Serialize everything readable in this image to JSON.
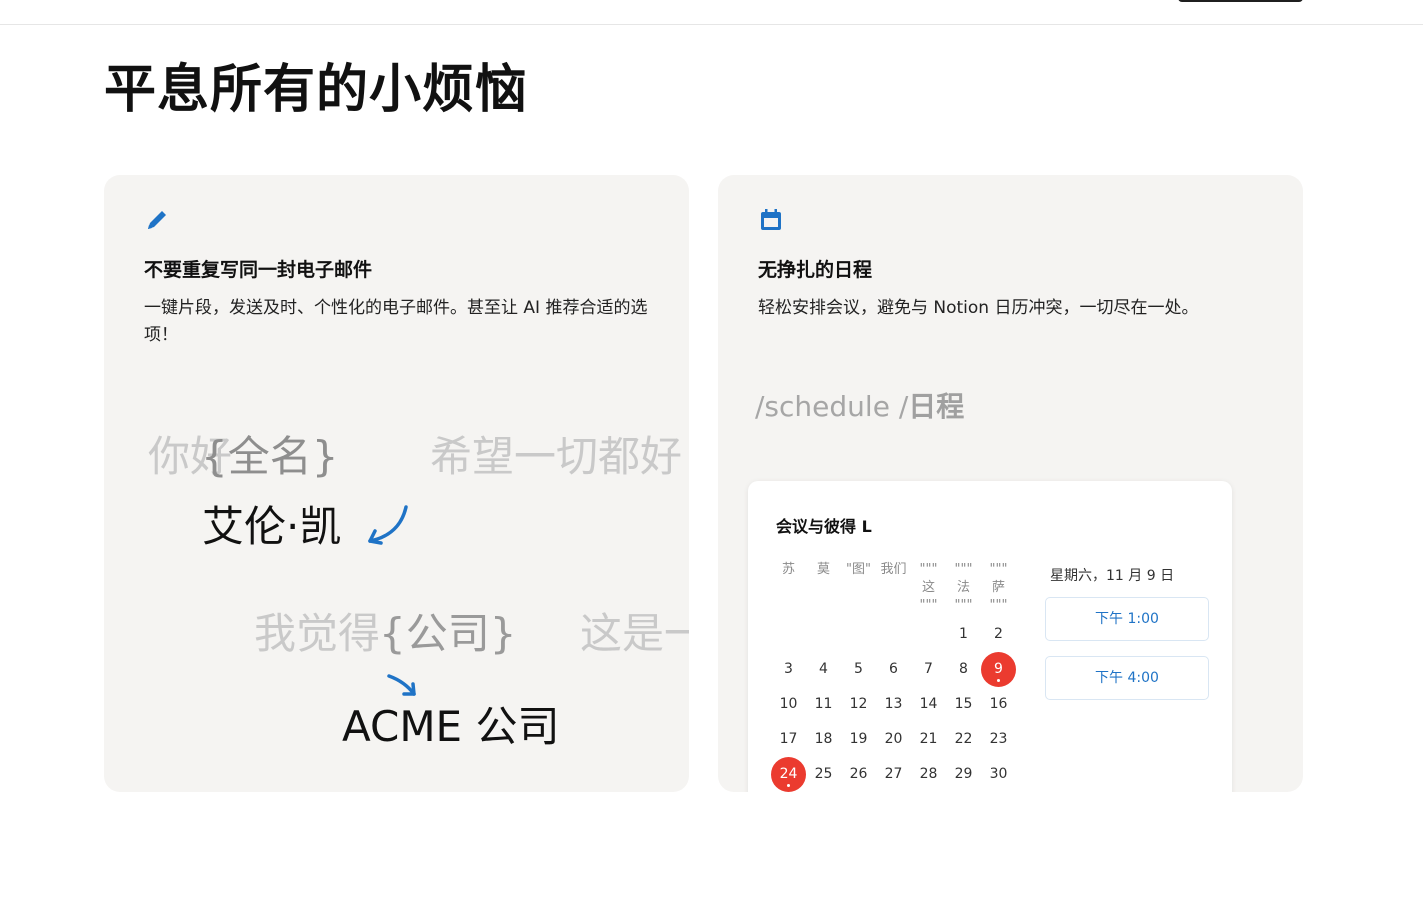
{
  "page": {
    "title": "平息所有的小烦恼"
  },
  "left_card": {
    "icon": "pencil-icon",
    "title": "不要重复写同一封电子邮件",
    "description": "一键片段，发送及时、个性化的电子邮件。甚至让 AI 推荐合适的选项！",
    "line1_ghost": "你好",
    "line1_var": "{全名}",
    "line1_right": "希望一切都好",
    "line2_name": "艾伦·凯",
    "line3_ghost": "我觉得",
    "line3_var": "{公司}",
    "line3_right": "这是一",
    "line4_company": "ACME 公司"
  },
  "right_card": {
    "icon": "calendar-icon",
    "title": "无挣扎的日程",
    "description": "轻松安排会议，避免与 Notion 日历冲突，一切尽在一处。",
    "command": "/schedule /",
    "command_bold": "日程",
    "panel": {
      "title": "会议与彼得 L",
      "weekdays": [
        "苏",
        "莫",
        "\"图\"",
        "我们",
        "\"\"\"\n这\n\"\"\"",
        "\"\"\"\n法\n\"\"\"",
        "\"\"\"\n萨\n\"\"\""
      ],
      "weeks": [
        [
          "",
          "",
          "",
          "",
          "",
          "1",
          "2"
        ],
        [
          "3",
          "4",
          "5",
          "6",
          "7",
          "8",
          "9"
        ],
        [
          "10",
          "11",
          "12",
          "13",
          "14",
          "15",
          "16"
        ],
        [
          "17",
          "18",
          "19",
          "20",
          "21",
          "22",
          "23"
        ],
        [
          "24",
          "25",
          "26",
          "27",
          "28",
          "29",
          "30"
        ]
      ],
      "highlighted_days": [
        "9",
        "24"
      ],
      "selected_date": "星期六，11 月 9 日",
      "slots": [
        "下午 1:00",
        "下午 4:00"
      ]
    }
  },
  "colors": {
    "accent": "#1f73c6",
    "highlight": "#eb3b2f",
    "card_bg": "#f5f4f2"
  }
}
